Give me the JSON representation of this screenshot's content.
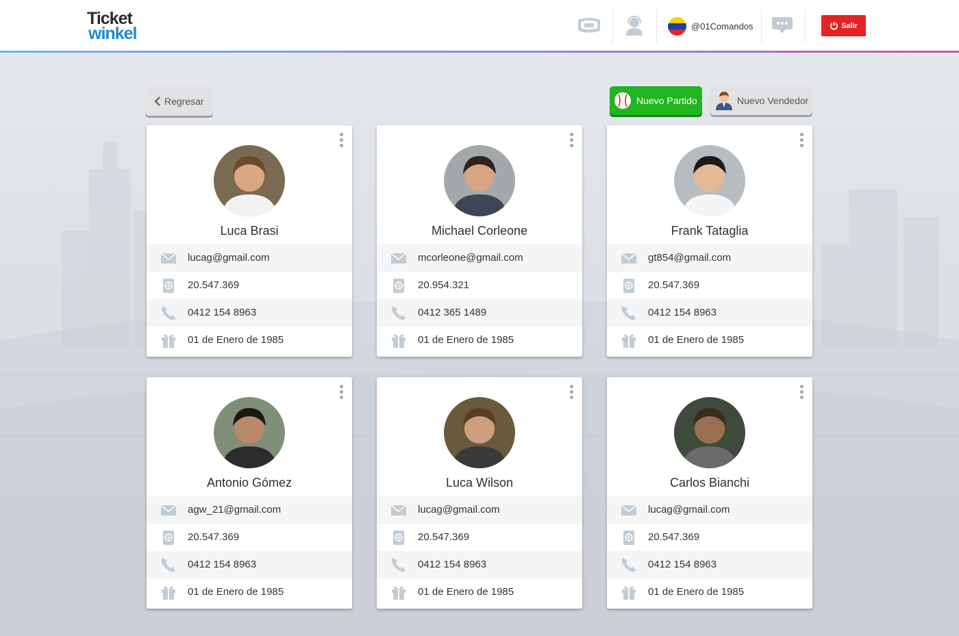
{
  "header": {
    "logo_top": "Ticket",
    "logo_bottom": "winkel",
    "username": "@01Comandos",
    "logout_label": "Salir",
    "icons": [
      "stadium-icon",
      "support-agent-icon",
      "venezuela-flag-icon",
      "chat-icon",
      "power-icon"
    ]
  },
  "actions": {
    "back_label": "Regresar",
    "new_match_label": "Nuevo Partido",
    "new_seller_label": "Nuevo Vendedor"
  },
  "colors": {
    "accent_green": "#21b521",
    "logout_red": "#e52222",
    "brand_blue": "#1f8ad1",
    "icon_gray": "#b9c3cc"
  },
  "cards": [
    {
      "name": "Luca Brasi",
      "email": "lucag@gmail.com",
      "id": "20.547.369",
      "phone": "0412 154 8963",
      "birthday": "01 de Enero de 1985"
    },
    {
      "name": "Michael Corleone",
      "email": "mcorleone@gmail.com",
      "id": "20.954.321",
      "phone": "0412 365 1489",
      "birthday": "01 de Enero de 1985"
    },
    {
      "name": "Frank Tataglia",
      "email": "gt854@gmail.com",
      "id": "20.547.369",
      "phone": "0412 154 8963",
      "birthday": "01 de Enero de 1985"
    },
    {
      "name": "Antonio Gómez",
      "email": "agw_21@gmail.com",
      "id": "20.547.369",
      "phone": "0412 154 8963",
      "birthday": "01 de Enero de 1985"
    },
    {
      "name": "Luca Wilson",
      "email": "lucag@gmail.com",
      "id": "20.547.369",
      "phone": "0412 154 8963",
      "birthday": "01 de Enero de 1985"
    },
    {
      "name": "Carlos Bianchi",
      "email": "lucag@gmail.com",
      "id": "20.547.369",
      "phone": "0412 154 8963",
      "birthday": "01 de Enero de 1985"
    }
  ]
}
